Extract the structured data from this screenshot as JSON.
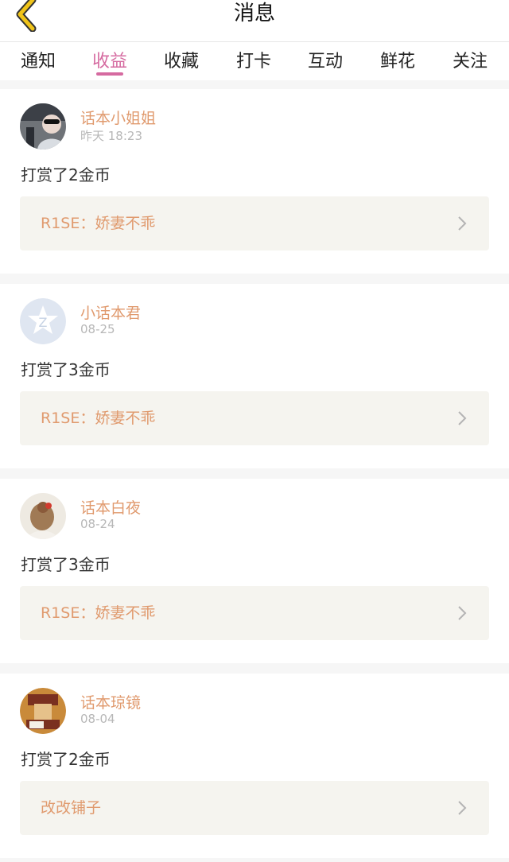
{
  "header": {
    "title": "消息",
    "back_icon": "chevron-left-icon",
    "accent_color": "#f0c419"
  },
  "tabs": [
    {
      "label": "通知",
      "active": false
    },
    {
      "label": "收益",
      "active": true
    },
    {
      "label": "收藏",
      "active": false
    },
    {
      "label": "打卡",
      "active": false
    },
    {
      "label": "互动",
      "active": false
    },
    {
      "label": "鲜花",
      "active": false
    },
    {
      "label": "关注",
      "active": false
    }
  ],
  "active_tab_color": "#d56aa0",
  "items": [
    {
      "user": "话本小姐姐",
      "time": "昨天 18:23",
      "message": "打赏了2金币",
      "target": "R1SE：娇妻不乖"
    },
    {
      "user": "小话本君",
      "time": "08-25",
      "message": "打赏了3金币",
      "target": "R1SE：娇妻不乖"
    },
    {
      "user": "话本白夜",
      "time": "08-24",
      "message": "打赏了3金币",
      "target": "R1SE：娇妻不乖"
    },
    {
      "user": "话本琼镜",
      "time": "08-04",
      "message": "打赏了2金币",
      "target": "改改铺子"
    }
  ]
}
